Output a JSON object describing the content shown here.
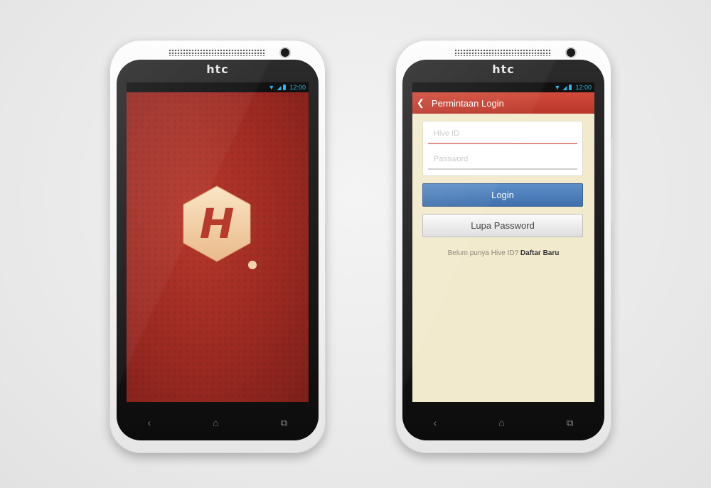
{
  "device": {
    "brand": "htc"
  },
  "status_bar": {
    "time": "12:00",
    "icons": [
      "wifi-icon",
      "signal-icon",
      "battery-icon"
    ],
    "accent": "#33b5e5"
  },
  "nav_bar": {
    "icons": [
      "back-icon",
      "home-icon",
      "recent-apps-icon"
    ]
  },
  "splash": {
    "logo_letter": "H",
    "background": "#9c2a22"
  },
  "login": {
    "title": "Permintaan Login",
    "hive_id_placeholder": "Hive ID",
    "password_placeholder": "Password",
    "login_button": "Login",
    "forgot_button": "Lupa Password",
    "register_prompt": "Belum punya Hive ID?",
    "register_link": "Daftar Baru",
    "colors": {
      "appbar": "#c8412f",
      "login_button": "#4a7cba",
      "background": "#f1eacd"
    }
  }
}
